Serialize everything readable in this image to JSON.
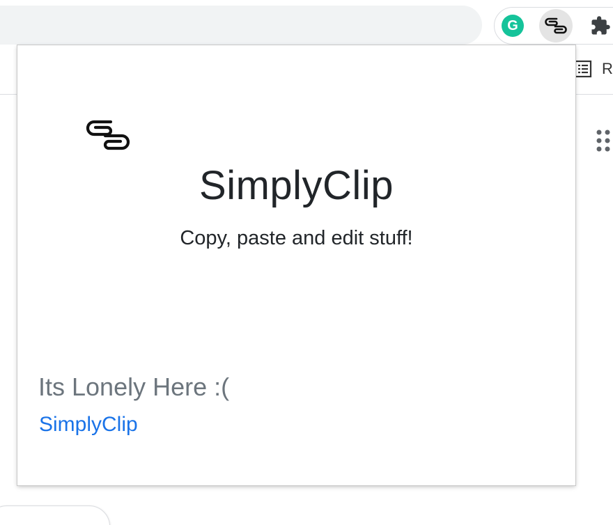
{
  "browser": {
    "extensions": [
      {
        "name": "Grammarly",
        "icon": "grammarly-icon",
        "glyph": "G"
      },
      {
        "name": "SimplyClip",
        "icon": "paperclip-icon"
      },
      {
        "name": "Extensions",
        "icon": "puzzle-icon"
      }
    ],
    "reading_list_label": "R"
  },
  "popup": {
    "logo_icon": "paperclip-icon",
    "title": "SimplyClip",
    "subtitle": "Copy, paste and edit stuff!",
    "empty_message": "Its Lonely Here :(",
    "link_label": "SimplyClip"
  },
  "colors": {
    "grammarly": "#15c39a",
    "link": "#1a73e8",
    "muted_text": "#6c757d",
    "title_text": "#212529"
  }
}
